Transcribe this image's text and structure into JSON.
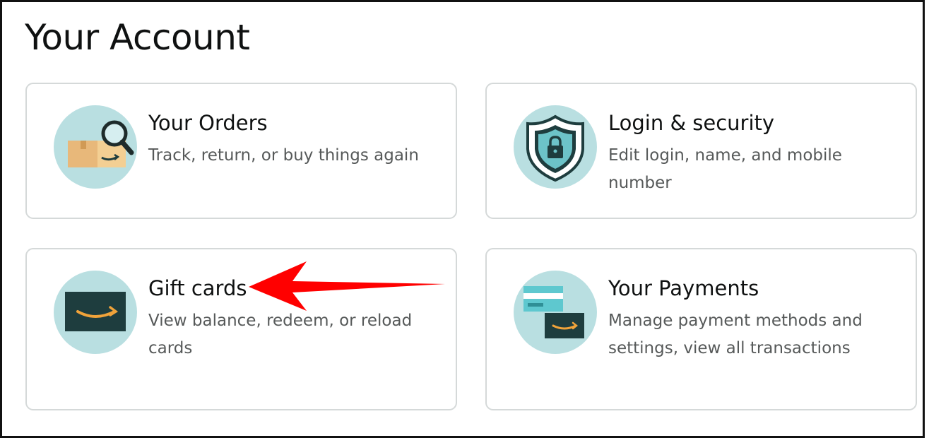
{
  "page": {
    "title": "Your Account"
  },
  "cards": [
    {
      "id": "orders",
      "title": "Your Orders",
      "description": "Track, return, or buy things again",
      "icon": "orders-box-magnifier-icon"
    },
    {
      "id": "login",
      "title": "Login & security",
      "description": "Edit login, name, and mobile number",
      "icon": "shield-lock-icon"
    },
    {
      "id": "gift",
      "title": "Gift cards",
      "description": "View balance, redeem, or reload cards",
      "icon": "gift-card-icon"
    },
    {
      "id": "payments",
      "title": "Your Payments",
      "description": "Manage payment methods and settings, view all transactions",
      "icon": "payment-cards-icon"
    }
  ],
  "colors": {
    "icon_circle": "#b9dfe1",
    "card_border": "#d5d9d9",
    "smile": "#f0a33a",
    "dark_card": "#1e3d3e",
    "annotation_arrow": "#ff0000"
  }
}
